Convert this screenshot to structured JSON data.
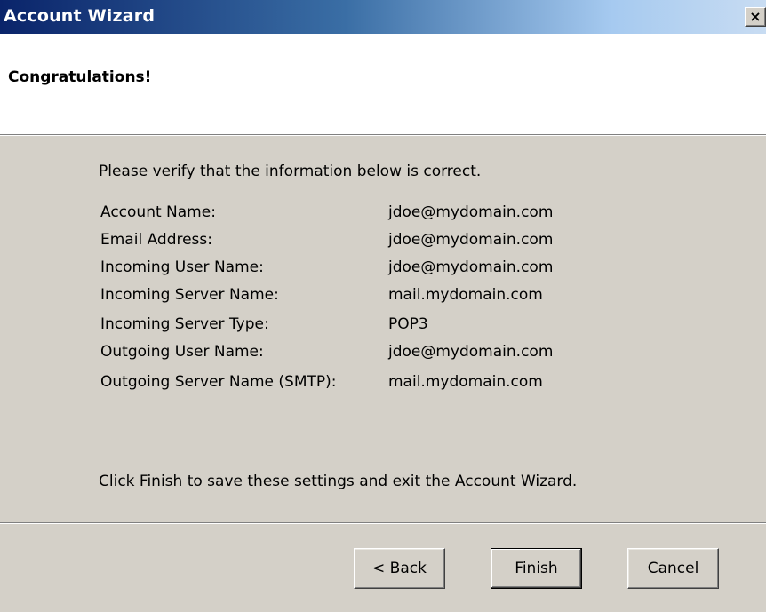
{
  "window": {
    "title": "Account Wizard",
    "close_glyph": "×"
  },
  "header": {
    "heading": "Congratulations!"
  },
  "body": {
    "verify_text": "Please verify that the information below is correct.",
    "rows": [
      {
        "label": "Account Name:",
        "value": "jdoe@mydomain.com"
      },
      {
        "label": "Email Address:",
        "value": "jdoe@mydomain.com"
      },
      {
        "label": "Incoming User Name:",
        "value": "jdoe@mydomain.com"
      },
      {
        "label": "Incoming Server Name:",
        "value": "mail.mydomain.com"
      },
      {
        "label": "Incoming Server Type:",
        "value": "POP3"
      },
      {
        "label": "Outgoing User Name:",
        "value": "jdoe@mydomain.com"
      },
      {
        "label": "Outgoing Server Name (SMTP):",
        "value": "mail.mydomain.com"
      }
    ],
    "finish_note": "Click Finish to save these settings and exit the Account Wizard."
  },
  "buttons": {
    "back_label": "< Back",
    "finish_label": "Finish",
    "cancel_label": "Cancel"
  },
  "colors": {
    "titlebar_start": "#0a246a",
    "titlebar_end": "#c8dcf2",
    "dialog_face": "#d4d0c8",
    "header_bg": "#ffffff"
  }
}
